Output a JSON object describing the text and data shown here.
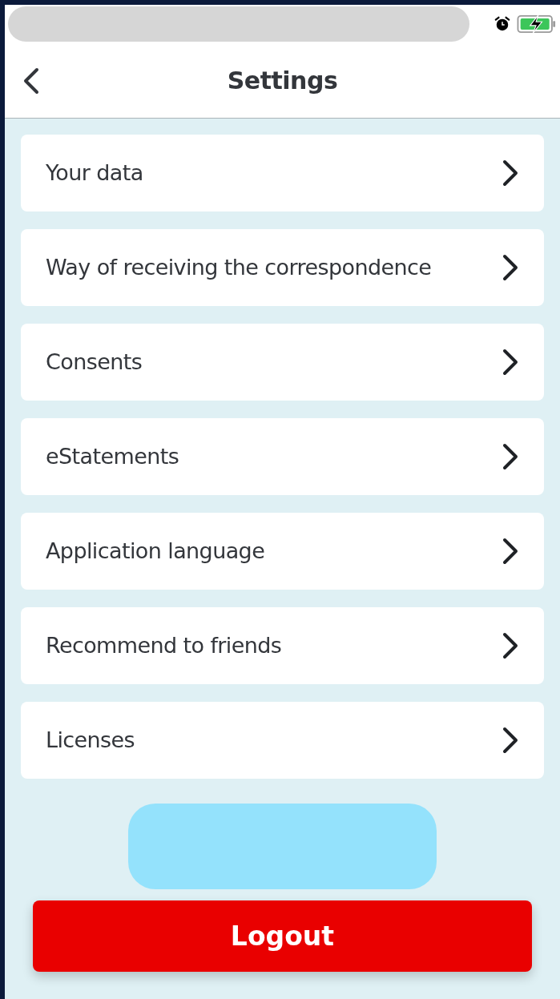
{
  "header": {
    "title": "Settings"
  },
  "menu_items": [
    "Your data",
    "Way of receiving the correspondence",
    "Consents",
    "eStatements",
    "Application language",
    "Recommend to friends",
    "Licenses"
  ],
  "logout_button": {
    "label": "Logout"
  }
}
